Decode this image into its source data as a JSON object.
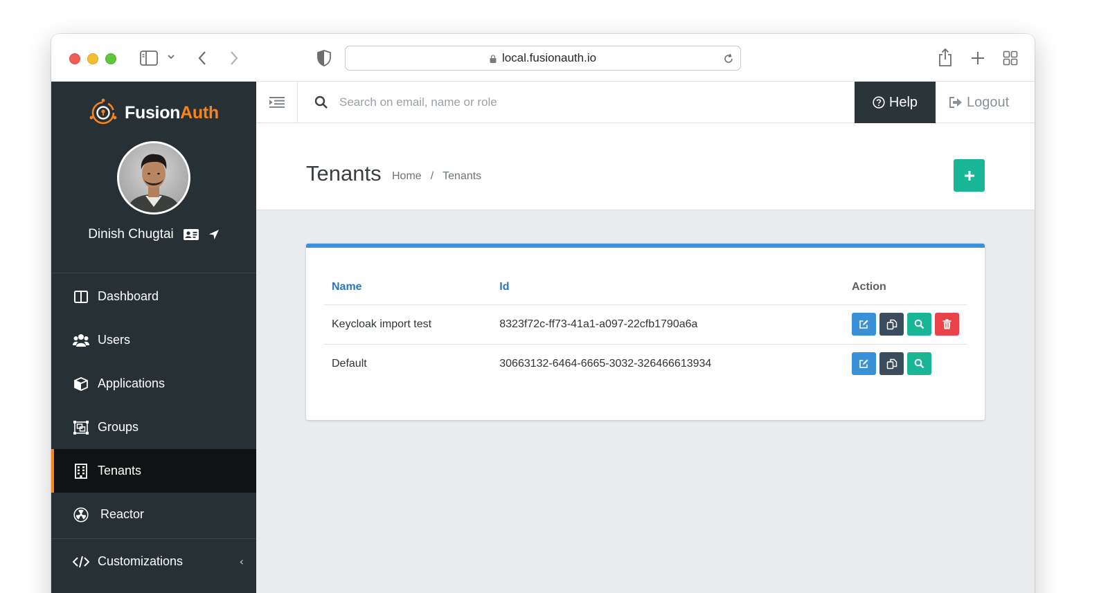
{
  "browser": {
    "url": "local.fusionauth.io"
  },
  "logo": {
    "fusion": "Fusion",
    "auth": "Auth"
  },
  "user": {
    "name": "Dinish Chugtai"
  },
  "sidebar": {
    "items": [
      {
        "label": "Dashboard",
        "icon": "columns-icon"
      },
      {
        "label": "Users",
        "icon": "users-icon"
      },
      {
        "label": "Applications",
        "icon": "cube-icon"
      },
      {
        "label": "Groups",
        "icon": "object-group-icon"
      },
      {
        "label": "Tenants",
        "icon": "building-icon",
        "active": true
      },
      {
        "label": "Reactor",
        "icon": "radiation-icon"
      },
      {
        "label": "Customizations",
        "icon": "code-icon"
      }
    ]
  },
  "topbar": {
    "search_placeholder": "Search on email, name or role",
    "help_label": "Help",
    "logout_label": "Logout"
  },
  "page": {
    "title": "Tenants",
    "breadcrumb": [
      "Home",
      "/",
      "Tenants"
    ]
  },
  "table": {
    "headers": {
      "name": "Name",
      "id": "Id",
      "action": "Action"
    },
    "rows": [
      {
        "name": "Keycloak import test",
        "id": "8323f72c-ff73-41a1-a097-22cfb1790a6a",
        "can_delete": true
      },
      {
        "name": "Default",
        "id": "30663132-6464-6665-3032-326466613934",
        "can_delete": false
      }
    ]
  },
  "colors": {
    "accent_orange": "#f58320",
    "sidebar_bg": "#273034",
    "edit_blue": "#3a91d8",
    "duplicate_navy": "#3b4c5c",
    "view_green": "#18b597",
    "delete_red": "#e8424b"
  }
}
